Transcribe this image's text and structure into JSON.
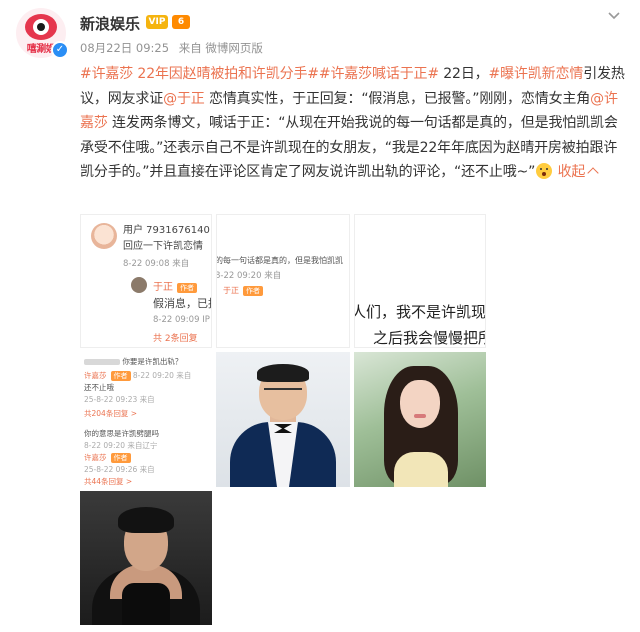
{
  "header": {
    "author": "新浪娱乐",
    "avatar_text": "嘻涮娱",
    "vip_badge": "VIP",
    "level_badge": "6",
    "verified_mark": "✓",
    "date": "08月22日 09:25",
    "source": "来自 微博网页版"
  },
  "post": {
    "seg1_tag": "#许嘉莎 22年因赵晴被拍和许凯分手#",
    "seg2_tag": "#许嘉莎喊话于正#",
    "seg3": " 22日，",
    "seg4_tag": "#曝许凯新恋情",
    "seg5": "引发热议，网友求证",
    "seg6_mention": "@于正",
    "seg7": " 恋情真实性，于正回复：“假消息，已报警。”刚刚，恋情女主角",
    "seg8_mention": "@许嘉莎",
    "seg9": " 连发两条博文，喊话于正：“从现在开始我说的每一句话都是真的，但是我怕凯凯会承受不住哦。”还表示自己不是许凯现在的女朋友，“我是22年年底因为赵晴开房被拍跟许凯分手的。”并且直接在评论区肯定了网友说许凯出轨的评论，“还不止哦~”",
    "collapse": "收起"
  },
  "images": {
    "img1": {
      "user": "用户 7931676140",
      "comment": "回应一下许凯恋情",
      "time1": "8-22 09:08 来自",
      "reply_user": "于正",
      "reply_tag": "作者",
      "reply_text": "假消息，已报",
      "time2": "8-22 09:09 IP",
      "more": "共 2条回复"
    },
    "img2": {
      "top": "的每一句话都是真的，但是我怕凯凯",
      "time": "8-22 09:20 来自",
      "user": "于正",
      "tag": "作者"
    },
    "img3": {
      "line1": "人们，我不是许凯现",
      "line2": "之后我会慢慢把所"
    },
    "img4": {
      "l1": "你要是许凯出轨？",
      "l2_user": "许嘉莎",
      "l2_tag": "作者",
      "l2_time": "8-22 09:20 来自",
      "l3": "还不止哦",
      "l4": "25-8-22 09:23 来自",
      "l5": "共204条回复 >",
      "l6": "你的意思是许凯劈腿吗",
      "l7": "8-22 09:20 来自辽宁",
      "l8_user": "许嘉莎",
      "l8_tag": "作者",
      "l9": "25-8-22 09:26 来自",
      "l10": "共44条回复 >"
    }
  }
}
